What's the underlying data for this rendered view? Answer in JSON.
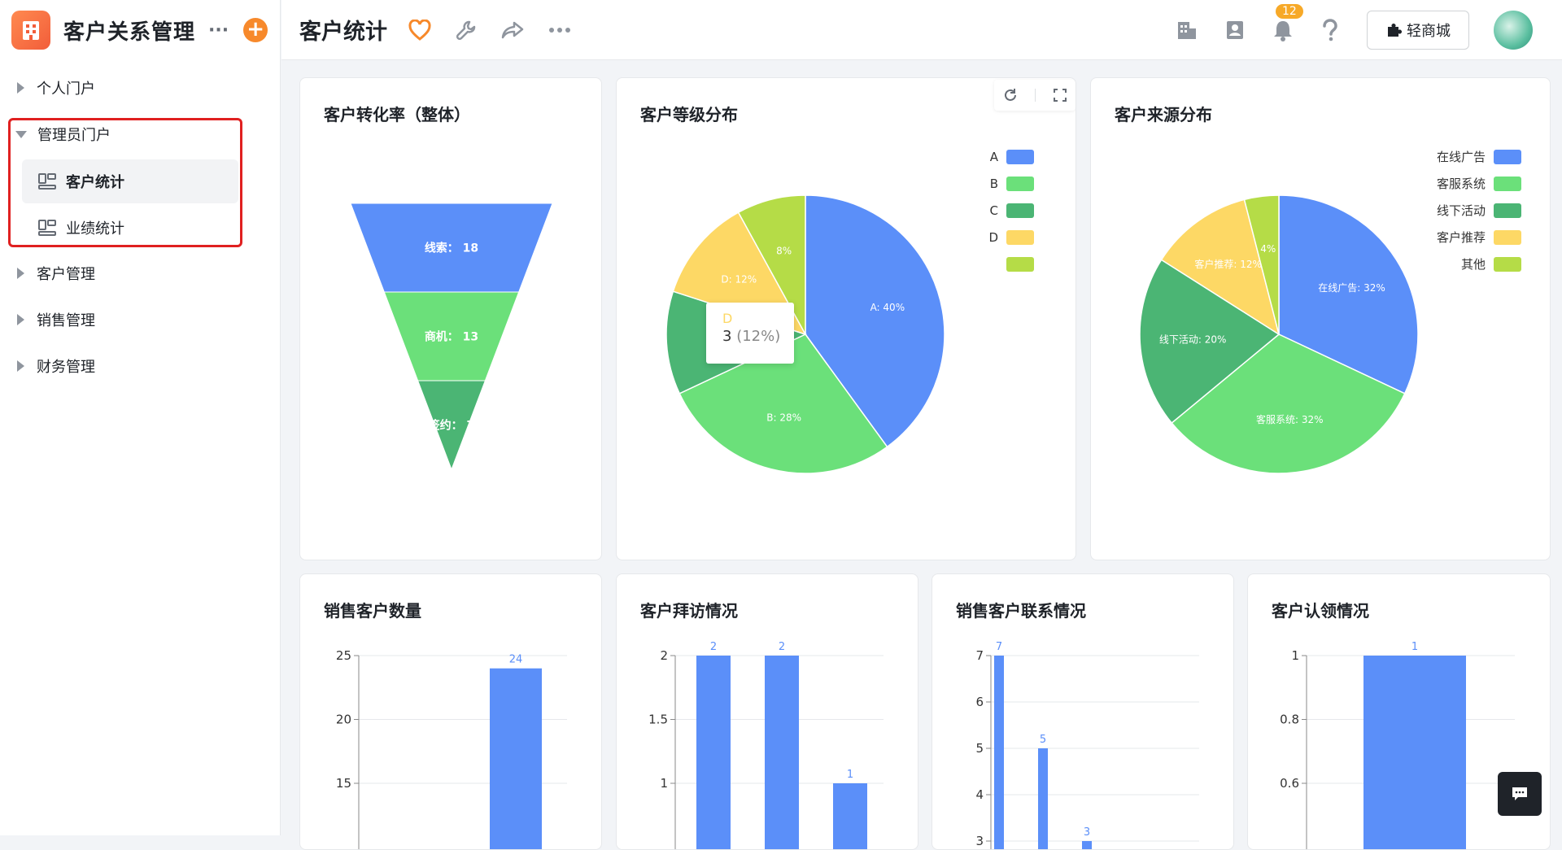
{
  "app": {
    "title": "客户关系管理",
    "more": "···",
    "add": "+"
  },
  "sidebar": {
    "items": [
      {
        "label": "个人门户"
      },
      {
        "label": "管理员门户"
      },
      {
        "label": "客户管理"
      },
      {
        "label": "销售管理"
      },
      {
        "label": "财务管理"
      }
    ],
    "sub_items": [
      {
        "label": "客户统计"
      },
      {
        "label": "业绩统计"
      }
    ]
  },
  "topbar": {
    "page_title": "客户统计",
    "notification_count": "12",
    "mall_label": "轻商城"
  },
  "cards": {
    "funnel": {
      "title": "客户转化率（整体）"
    },
    "level": {
      "title": "客户等级分布"
    },
    "source": {
      "title": "客户来源分布"
    },
    "sales_count": {
      "title": "销售客户数量"
    },
    "visits": {
      "title": "客户拜访情况"
    },
    "contacts": {
      "title": "销售客户联系情况"
    },
    "claims": {
      "title": "客户认领情况"
    }
  },
  "colors": {
    "accent": "#f7892b",
    "blue": "#5b8ff9",
    "green": "#6be07a",
    "dark_green": "#4bb574",
    "yellow": "#fdd865",
    "lime": "#b5dc47"
  },
  "chart_data": [
    {
      "type": "funnel",
      "title": "客户转化率（整体）",
      "stages": [
        {
          "label": "线索",
          "value": 18
        },
        {
          "label": "商机",
          "value": 13
        },
        {
          "label": "签约",
          "value": 7
        }
      ]
    },
    {
      "type": "pie",
      "title": "客户等级分布",
      "legend": [
        "A",
        "B",
        "C",
        "D",
        ""
      ],
      "slices": [
        {
          "name": "A",
          "percent": 40,
          "label": "A: 40%"
        },
        {
          "name": "B",
          "percent": 28,
          "label": "B: 28%"
        },
        {
          "name": "C",
          "percent": 12,
          "label": ""
        },
        {
          "name": "D",
          "percent": 12,
          "label": "D: 12%"
        },
        {
          "name": "",
          "percent": 8,
          "label": "8%"
        }
      ],
      "tooltip": {
        "name": "D",
        "value": "3",
        "percent": "(12%)"
      }
    },
    {
      "type": "pie",
      "title": "客户来源分布",
      "legend": [
        "在线广告",
        "客服系统",
        "线下活动",
        "客户推荐",
        "其他"
      ],
      "slices": [
        {
          "name": "在线广告",
          "percent": 32,
          "label": "在线广告: 32%"
        },
        {
          "name": "客服系统",
          "percent": 32,
          "label": "客服系统: 32%"
        },
        {
          "name": "线下活动",
          "percent": 20,
          "label": "线下活动: 20%"
        },
        {
          "name": "客户推荐",
          "percent": 12,
          "label": "客户推荐: 12%"
        },
        {
          "name": "其他",
          "percent": 4,
          "label": "4%"
        }
      ]
    },
    {
      "type": "bar",
      "title": "销售客户数量",
      "yticks": [
        "25",
        "20",
        "15"
      ],
      "ylim": [
        15,
        25
      ],
      "bars": [
        {
          "value": 24,
          "label": "24"
        }
      ]
    },
    {
      "type": "bar",
      "title": "客户拜访情况",
      "yticks": [
        "2",
        "1.5",
        "1"
      ],
      "ylim": [
        1,
        2
      ],
      "bars": [
        {
          "value": 2,
          "label": "2"
        },
        {
          "value": 2,
          "label": "2"
        },
        {
          "value": 1,
          "label": "1"
        }
      ]
    },
    {
      "type": "bar",
      "title": "销售客户联系情况",
      "yticks": [
        "7",
        "6",
        "5",
        "4",
        "3"
      ],
      "ylim": [
        3,
        7
      ],
      "bars": [
        {
          "value": 7,
          "label": "7"
        },
        {
          "value": 5,
          "label": "5"
        },
        {
          "value": 3,
          "label": "3"
        }
      ]
    },
    {
      "type": "bar",
      "title": "客户认领情况",
      "yticks": [
        "1",
        "0.8",
        "0.6"
      ],
      "ylim": [
        0.6,
        1
      ],
      "bars": [
        {
          "value": 1,
          "label": "1"
        }
      ]
    }
  ]
}
